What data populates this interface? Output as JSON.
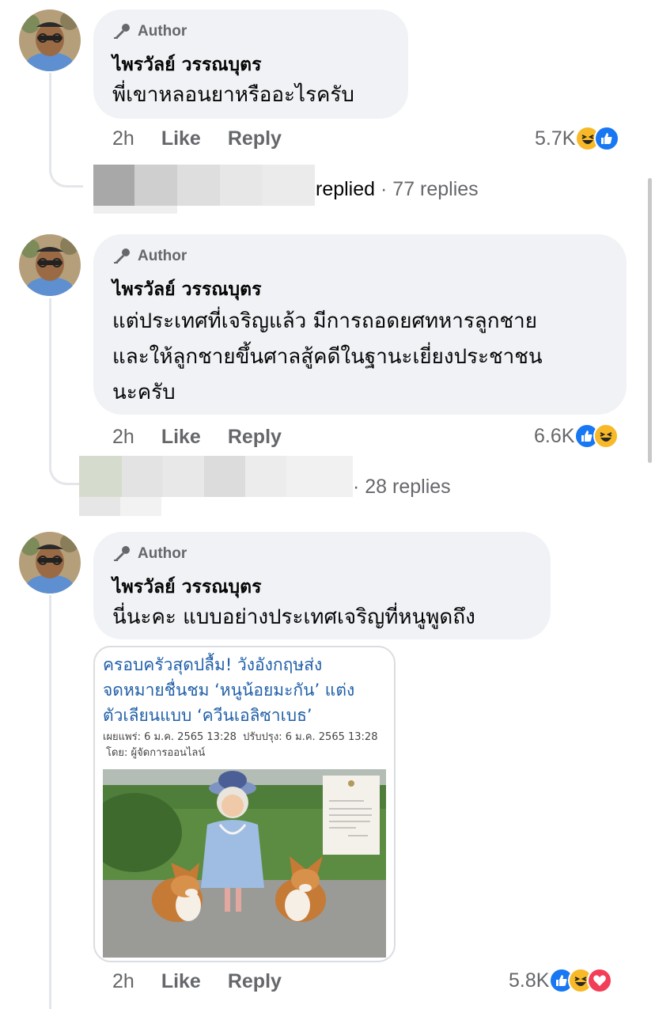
{
  "comments": [
    {
      "author_badge": "Author",
      "name": "ไพรวัลย์ วรรณบุตร",
      "lines": [
        "พี่เขาหลอนยาหรืออะไรครับ"
      ],
      "time": "2h",
      "like_label": "Like",
      "reply_label": "Reply",
      "reaction_count": "5.7K",
      "reactions": [
        "haha-icon",
        "like-icon"
      ],
      "replies_prefix": "replied",
      "replies_text": "· 77 replies"
    },
    {
      "author_badge": "Author",
      "name": "ไพรวัลย์ วรรณบุตร",
      "lines": [
        "แต่ประเทศที่เจริญแล้ว มีการถอดยศทหารลูกชาย",
        "และให้ลูกชายขึ้นศาลสู้คดีในฐานะเยี่ยงประชาชน",
        "นะครับ"
      ],
      "time": "2h",
      "like_label": "Like",
      "reply_label": "Reply",
      "reaction_count": "6.6K",
      "reactions": [
        "like-icon",
        "haha-icon"
      ],
      "replies_text": "· 28 replies"
    },
    {
      "author_badge": "Author",
      "name": "ไพรวัลย์ วรรณบุตร",
      "lines": [
        "นี่นะคะ แบบอย่างประเทศเจริญที่หนูพูดถึง"
      ],
      "time": "2h",
      "like_label": "Like",
      "reply_label": "Reply",
      "reaction_count": "5.8K",
      "reactions": [
        "like-icon",
        "haha-icon",
        "love-icon"
      ],
      "attachment": {
        "title_lines": [
          "ครอบครัวสุดปลื้ม! วังอังกฤษส่ง",
          "จดหมายชื่นชม ‘หนูน้อยมะกัน’ แต่ง",
          "ตัวเลียนแบบ ‘ควีนเอลิซาเบธ’"
        ],
        "published": "เผยแพร่: 6 ม.ค. 2565 13:28",
        "updated": "ปรับปรุง: 6 ม.ค. 2565 13:28",
        "byline": "โดย: ผู้จัดการออนไลน์"
      }
    }
  ],
  "colors": {
    "bubble": "#f0f2f5",
    "meta_text": "#65676b",
    "thread_line": "#e4e6eb",
    "like_blue": "#1877f2",
    "haha_yellow": "#f7b928",
    "love_red": "#f33e58",
    "card_title": "#1f5fa8"
  }
}
